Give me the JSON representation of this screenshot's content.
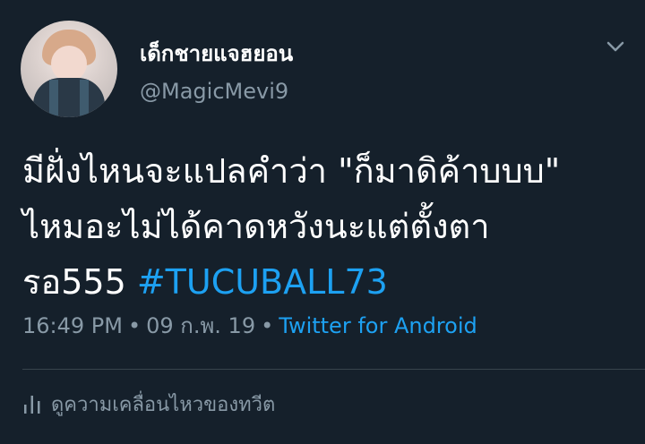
{
  "author": {
    "display_name": "เด็กชายแจฮยอน",
    "handle": "@MagicMevi9"
  },
  "tweet": {
    "line1": "มีฝั่งไหนจะแปลคำว่า \"ก็มาดิค้าบบบ\"",
    "line2": "ไหมอะไม่ได้คาดหวังนะแต่ตั้งตา",
    "line3_prefix": "รอ555 ",
    "hashtag": "#TUCUBALL73"
  },
  "meta": {
    "time": "16:49 PM",
    "separator": "•",
    "date": "09 ก.พ. 19",
    "source": "Twitter for Android"
  },
  "activity": {
    "label": "ดูความเคลื่อนไหวของทวีต",
    "icon": "bar-chart-icon"
  },
  "icons": {
    "menu": "chevron-down-icon"
  },
  "colors": {
    "background": "#15202b",
    "primary_text": "#ffffff",
    "secondary_text": "#8899a6",
    "accent": "#1da1f2",
    "divider": "#38444d"
  }
}
